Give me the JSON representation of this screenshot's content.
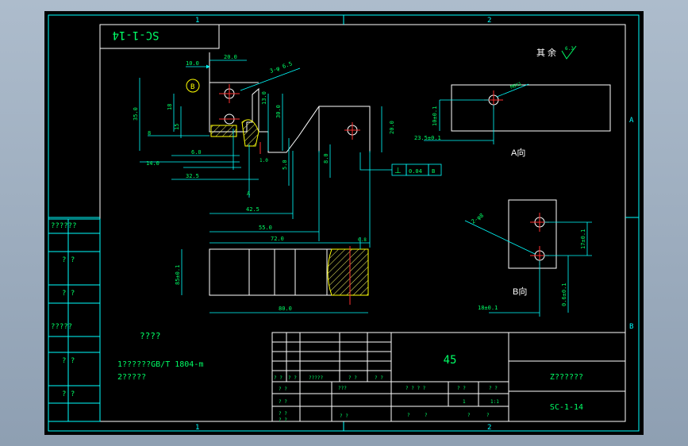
{
  "frame": {
    "zone_cols": [
      "1",
      "2"
    ],
    "zone_rows": [
      "A",
      "B"
    ]
  },
  "title_stamp": "SC-1-14",
  "roughness_note": {
    "label": "其 余",
    "value": "6.3"
  },
  "side_block": {
    "labels": [
      "??????",
      "? ?",
      "? ?",
      "?????",
      "? ?",
      "? ?"
    ]
  },
  "front_view": {
    "dims": {
      "d10": "10.0",
      "d20": "20.0",
      "d35": "35.0",
      "d18": "18",
      "d15": "15",
      "d8": "8",
      "d6": "6.0",
      "d14": "14.0",
      "d325": "32.5",
      "d13": "13.0",
      "d30": "30.0",
      "d50": "5.0",
      "d20b": "20.0",
      "d80": "8.0",
      "d425": "42.5",
      "d55": "55.0",
      "d72": "72.0",
      "d10b": "1.0"
    },
    "hole_note": "3-φ 6.5",
    "datum_B": "B",
    "datum_A": "A",
    "gdt": {
      "symbol": "⊥",
      "tolerance": "0.04",
      "datum": "B"
    }
  },
  "bottom_view": {
    "dims": {
      "height": "85±0.1",
      "width": "80.0"
    },
    "roughness": "0.8"
  },
  "view_a": {
    "title": "A向",
    "dims": {
      "v": "10±0.1",
      "h": "23.5±0.1"
    },
    "hole": "M6X1"
  },
  "view_b": {
    "title": "B向",
    "dims": {
      "v1": "17±0.1",
      "v2": "0.6±0.1",
      "h": "18±0.1"
    },
    "hole": "2-φ8"
  },
  "notes": {
    "title": "????",
    "items": [
      "1??????GB/T 1804-m",
      "2?????"
    ]
  },
  "title_block": {
    "material": "45",
    "company": "Z??????",
    "drawing_no": "SC-1-14",
    "sign_row": [
      "? ?",
      "? ?",
      "?????",
      "? ?",
      "? ?"
    ],
    "left_labels": [
      "? ?",
      "? ?",
      "? ?",
      "? ?"
    ],
    "mid_label_1": "???",
    "mid_label_2": "? ?",
    "stage_header": [
      "? ? ? ?",
      "? ?",
      "? ?"
    ],
    "stage_values": [
      "1",
      "1:1"
    ],
    "sheet_row": [
      "?",
      "?",
      "?",
      "?"
    ]
  }
}
